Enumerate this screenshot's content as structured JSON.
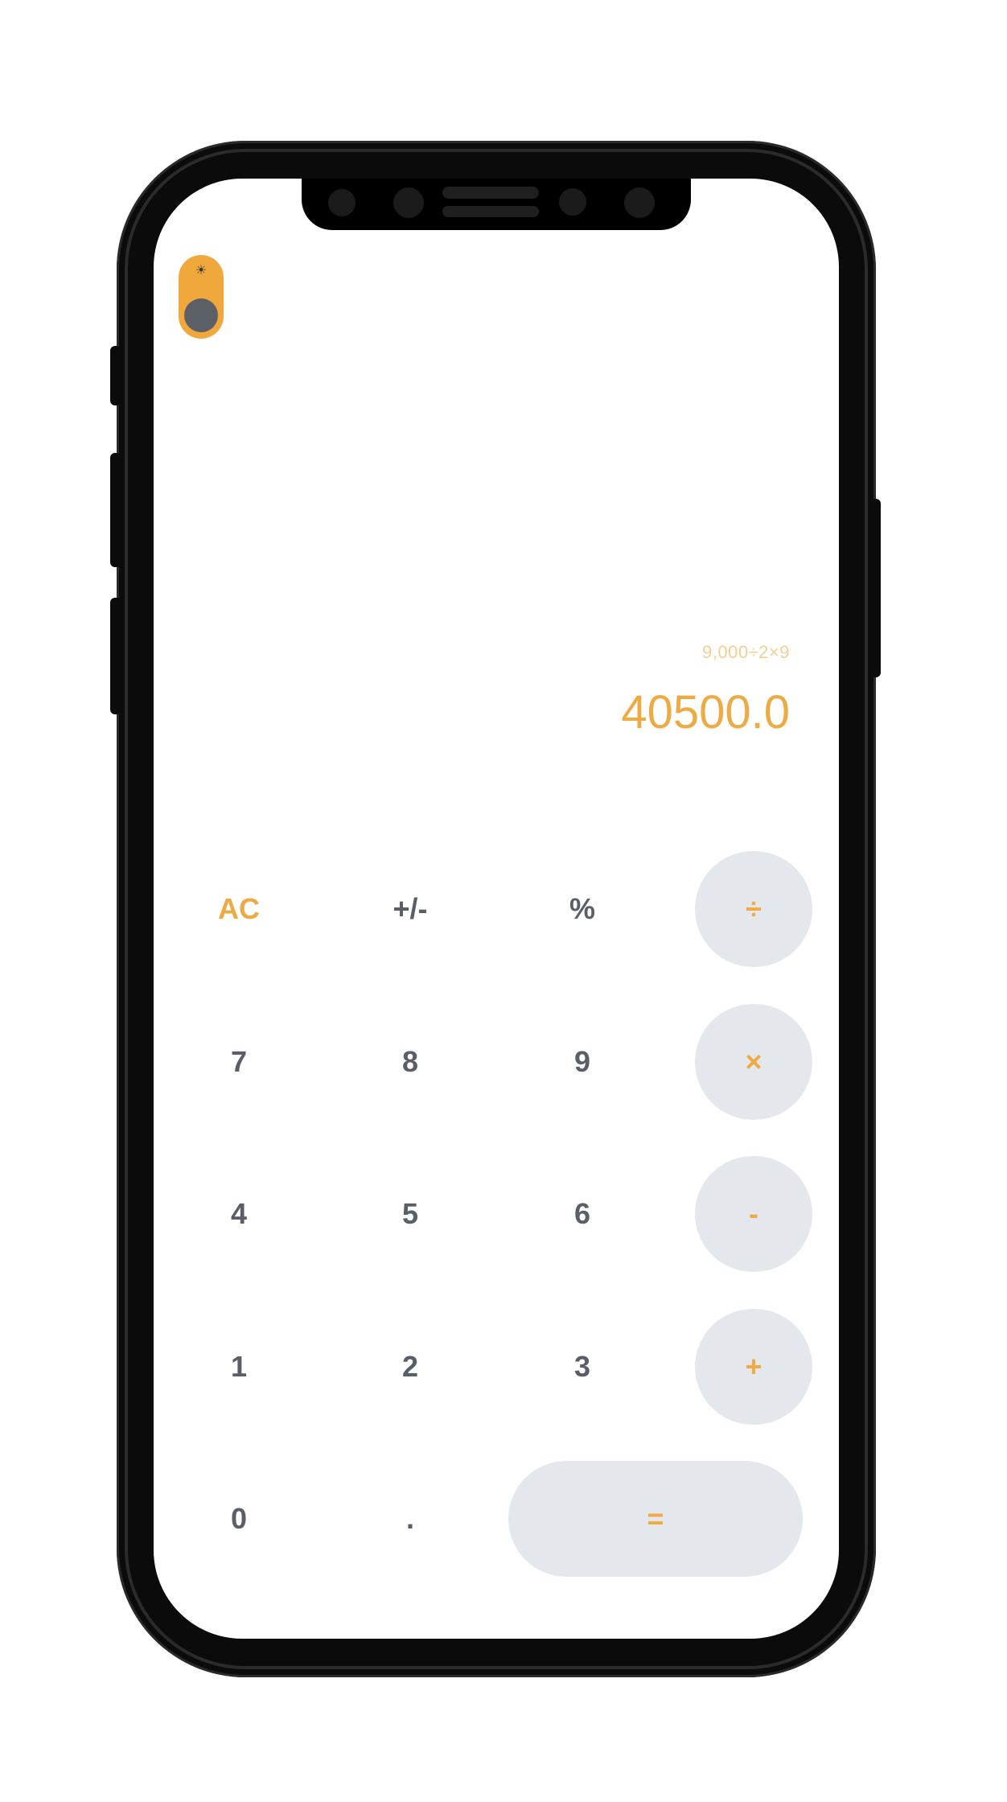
{
  "theme_toggle": {
    "icon": "sun-icon",
    "glyph": "☀",
    "state": "light"
  },
  "display": {
    "expression": "9,000÷2×9",
    "result": "40500.0"
  },
  "keypad": {
    "ac": "AC",
    "sign": "+/-",
    "percent": "%",
    "divide": "÷",
    "seven": "7",
    "eight": "8",
    "nine": "9",
    "multiply": "×",
    "four": "4",
    "five": "5",
    "six": "6",
    "minus": "-",
    "one": "1",
    "two": "2",
    "three": "3",
    "plus": "+",
    "zero": "0",
    "dot": ".",
    "equals": "="
  },
  "colors": {
    "accent": "#eeaa43",
    "accent_light": "#f3cf92",
    "digit": "#5a5e66",
    "operator_bg": "#e4e8ec",
    "toggle_bg": "#f0a83c",
    "frame": "#0b0b0b"
  }
}
